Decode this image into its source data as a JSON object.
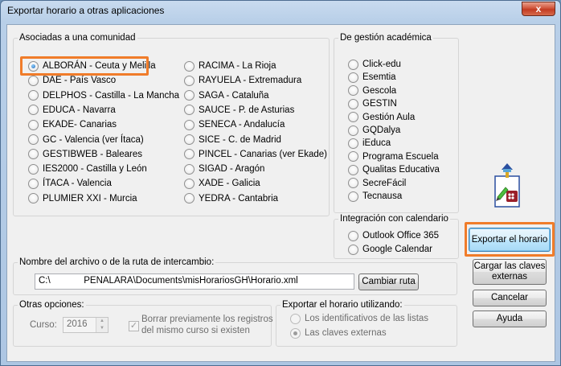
{
  "window": {
    "title": "Exportar horario a otras aplicaciones",
    "close_glyph": "x"
  },
  "comunidad": {
    "legend": "Asociadas a una comunidad",
    "left": [
      {
        "label": "ALBORÁN - Ceuta y Melilla",
        "selected": true
      },
      {
        "label": "DAE - País Vasco"
      },
      {
        "label": "DELPHOS - Castilla - La Mancha"
      },
      {
        "label": "EDUCA - Navarra"
      },
      {
        "label": "EKADE- Canarias"
      },
      {
        "label": "GC - Valencia (ver Ítaca)"
      },
      {
        "label": "GESTIBWEB -  Baleares"
      },
      {
        "label": "IES2000 - Castilla y León"
      },
      {
        "label": "ÍTACA - Valencia"
      },
      {
        "label": "PLUMIER XXI - Murcia"
      }
    ],
    "right": [
      {
        "label": "RACIMA - La Rioja"
      },
      {
        "label": "RAYUELA - Extremadura"
      },
      {
        "label": "SAGA - Cataluña"
      },
      {
        "label": "SAUCE - P. de Asturias"
      },
      {
        "label": "SENECA - Andalucía"
      },
      {
        "label": "SICE - C. de Madrid"
      },
      {
        "label": "PINCEL - Canarias (ver Ekade)"
      },
      {
        "label": "SIGAD - Aragón"
      },
      {
        "label": "XADE - Galicia"
      },
      {
        "label": "YEDRA - Cantabria"
      }
    ]
  },
  "academica": {
    "legend": "De gestión académica",
    "items": [
      {
        "label": "Click-edu"
      },
      {
        "label": "Esemtia"
      },
      {
        "label": "Gescola"
      },
      {
        "label": "GESTIN"
      },
      {
        "label": "Gestión Aula"
      },
      {
        "label": "GQDalya"
      },
      {
        "label": "iEduca"
      },
      {
        "label": "Programa Escuela"
      },
      {
        "label": "Qualitas Educativa"
      },
      {
        "label": "SecreFácil"
      },
      {
        "label": "Tecnausa"
      }
    ]
  },
  "calendario": {
    "legend": "Integración con calendario",
    "items": [
      {
        "label": "Outlook Office 365"
      },
      {
        "label": "Google Calendar"
      }
    ]
  },
  "archivo": {
    "legend": "Nombre del archivo o de la ruta de intercambio:",
    "path": "C:\\             PENALARA\\Documents\\misHorariosGH\\Horario.xml",
    "change_button": "Cambiar ruta"
  },
  "otras": {
    "legend": "Otras opciones:",
    "curso_label": "Curso:",
    "curso_value": "2016",
    "borrar_line1": "Borrar previamente los registros",
    "borrar_line2": "del mismo curso si existen",
    "borrar_checked": true
  },
  "exportar_usando": {
    "legend": "Exportar el horario utilizando:",
    "items": [
      {
        "label": "Los identificativos de las listas"
      },
      {
        "label": "Las claves externas",
        "selected": true
      }
    ]
  },
  "buttons": {
    "export": "Exportar el horario",
    "load_keys_line1": "Cargar las claves",
    "load_keys_line2": "externas",
    "cancel": "Cancelar",
    "help": "Ayuda"
  },
  "colors": {
    "highlight": "#f07c2a",
    "selected_radio": "#1f64b4"
  },
  "icons": {
    "export_icon": "calendar-export-icon"
  }
}
